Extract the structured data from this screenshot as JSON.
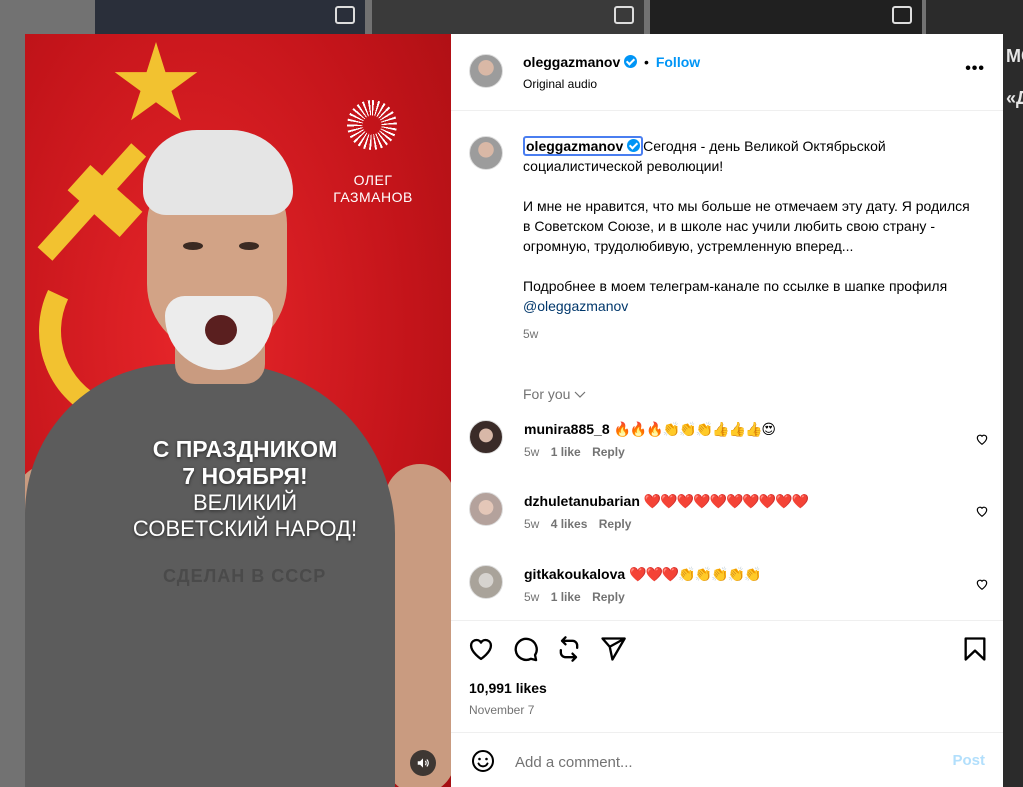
{
  "post": {
    "username": "oleggazmanov",
    "follow_label": "Follow",
    "dot": "•",
    "audio": "Original audio",
    "more_label": "•••",
    "caption_paragraphs": [
      "Сегодня - день Великой Октябрьской социалистической революции!",
      "И мне не нравится, что мы больше не отмечаем эту дату. Я родился в Советском Союзе, и в школе нас учили любить свою страну - огромную, трудолюбивую, устремленную вперед...",
      "Подробнее в моем телеграм-канале по ссылке в шапке профиля"
    ],
    "caption_mention": "@oleggazmanov",
    "caption_time": "5w",
    "for_you": "For you",
    "likes": "10,991 likes",
    "date": "November 7",
    "comment_placeholder": "Add a comment...",
    "post_label": "Post"
  },
  "media": {
    "logo_line1": "ОЛЕГ",
    "logo_line2": "ГАЗМАНОВ",
    "greeting_line1": "С ПРАЗДНИКОМ",
    "greeting_line2": "7 НОЯБРЯ!",
    "greeting_line3": "ВЕЛИКИЙ",
    "greeting_line4": "СОВЕТСКИЙ НАРОД!",
    "shirt_text": "СДЕЛАН В СССР"
  },
  "comments": [
    {
      "user": "munira885_8",
      "text": "🔥🔥🔥👏👏👏👍👍👍😍",
      "time": "5w",
      "likes": "1 like",
      "reply": "Reply"
    },
    {
      "user": "dzhuletanubarian",
      "text": "❤️❤️❤️❤️❤️❤️❤️❤️❤️❤️",
      "time": "5w",
      "likes": "4 likes",
      "reply": "Reply"
    },
    {
      "user": "gitkakoukalova",
      "text": "❤️❤️❤️👏👏👏👏👏",
      "time": "5w",
      "likes": "1 like",
      "reply": "Reply"
    }
  ],
  "background": {
    "right_fragment_1": "МС",
    "right_fragment_2": "«Д"
  },
  "colors": {
    "accent": "#0095f6",
    "media_red": "#c3141a",
    "soviet_gold": "#f2c230",
    "post_disabled": "#b2dffc"
  }
}
